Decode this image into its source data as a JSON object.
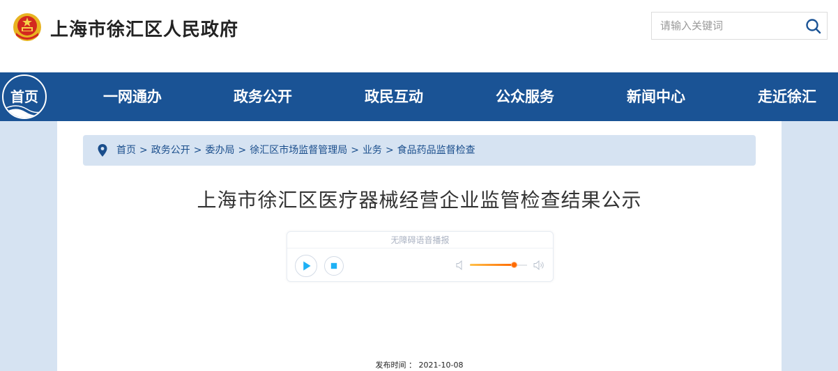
{
  "header": {
    "site_title": "上海市徐汇区人民政府",
    "emblem_icon": "national-emblem-icon",
    "search": {
      "placeholder": "请输入关键词",
      "value": "",
      "icon": "search-icon"
    }
  },
  "nav": {
    "home_label": "首页",
    "items": [
      {
        "label": "一网通办"
      },
      {
        "label": "政务公开"
      },
      {
        "label": "政民互动"
      },
      {
        "label": "公众服务"
      },
      {
        "label": "新闻中心"
      },
      {
        "label": "走近徐汇"
      }
    ]
  },
  "breadcrumb": {
    "icon": "location-pin-icon",
    "items": [
      "首页",
      "政务公开",
      "委办局",
      "徐汇区市场监督管理局",
      "业务",
      "食品药品监督检查"
    ],
    "separator": ">"
  },
  "article": {
    "title": "上海市徐汇区医疗器械经营企业监管检查结果公示",
    "publish_label": "发布时间",
    "publish_sep": "：",
    "publish_date": "2021-10-08"
  },
  "player": {
    "title": "无障碍语音播报",
    "volume_percent": 77
  },
  "colors": {
    "nav_bg": "#1a5395",
    "page_bg": "#d6e3f2",
    "link": "#1a4e8c",
    "accent_play": "#1eb1f5",
    "volume": "#ff6a00"
  }
}
